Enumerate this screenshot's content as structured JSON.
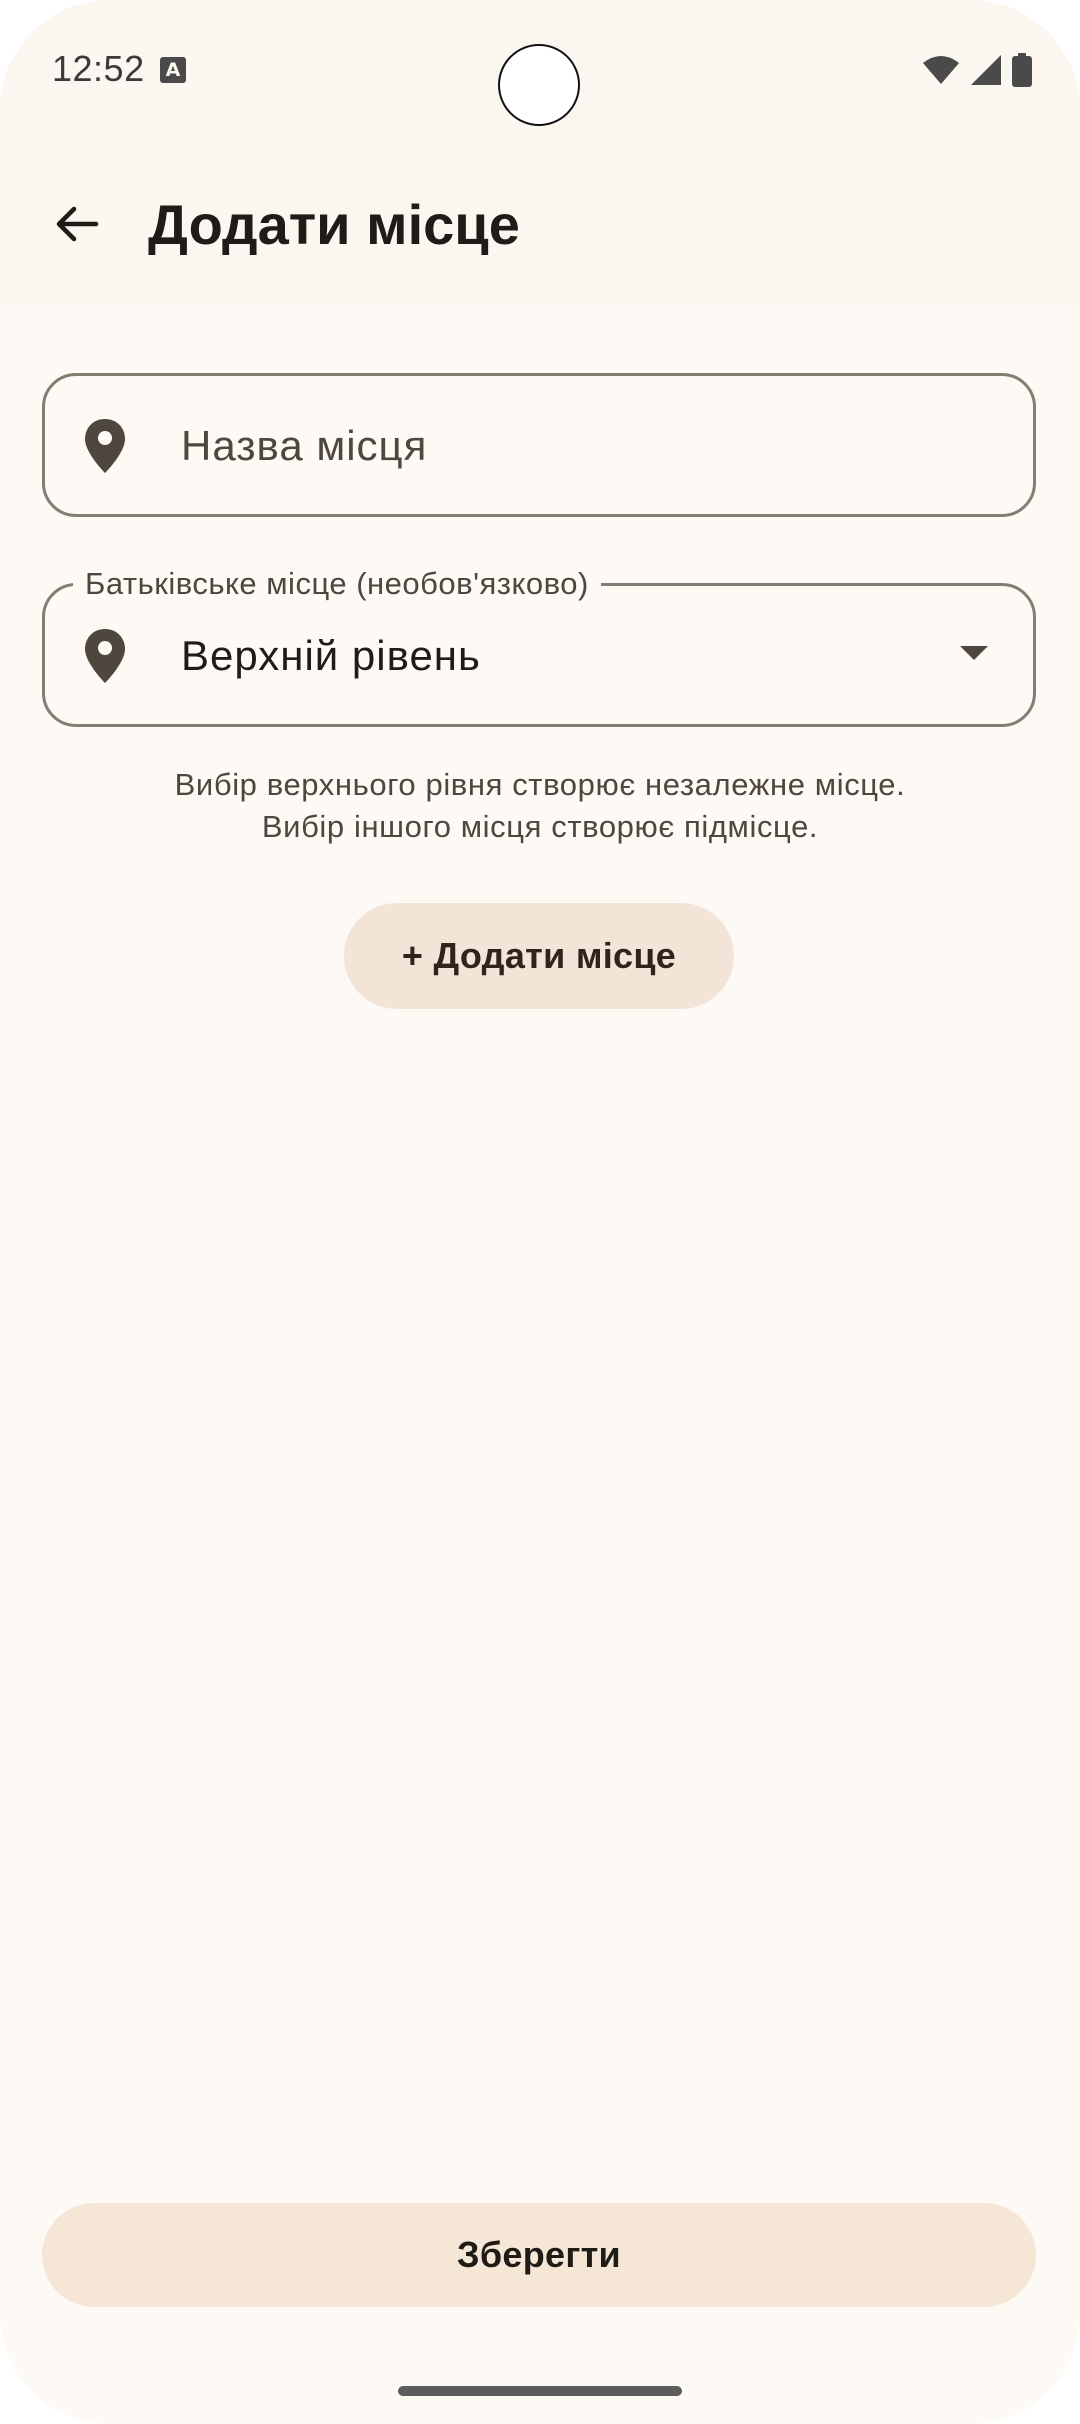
{
  "status_bar": {
    "time": "12:52",
    "notification_icon_letter": "A",
    "icons": [
      "wifi-icon",
      "signal-icon",
      "battery-icon"
    ]
  },
  "app_bar": {
    "title": "Додати місце",
    "back_icon": "arrow-back-icon"
  },
  "form": {
    "name_field": {
      "placeholder": "Назва місця",
      "value": "",
      "icon": "location-pin-icon"
    },
    "parent_field": {
      "label": "Батьківське місце (необов'язково)",
      "value": "Верхній рівень",
      "icon": "location-pin-icon",
      "dropdown_icon": "dropdown-arrow-icon"
    },
    "helper_lines": [
      "Вибір верхнього рівня створює незалежне місце.",
      "Вибір іншого місця створює підмісце."
    ],
    "add_place_label": "+ Додати місце"
  },
  "footer": {
    "save_label": "Зберегти"
  },
  "colors": {
    "background": "#fdf9f5",
    "top_bar": "#fbf6ef",
    "outline": "#857c72",
    "tonal_button": "#f3e4d8",
    "save_button": "#f5e6d5",
    "text_primary": "#1f1b16",
    "text_secondary": "#4f463d"
  }
}
